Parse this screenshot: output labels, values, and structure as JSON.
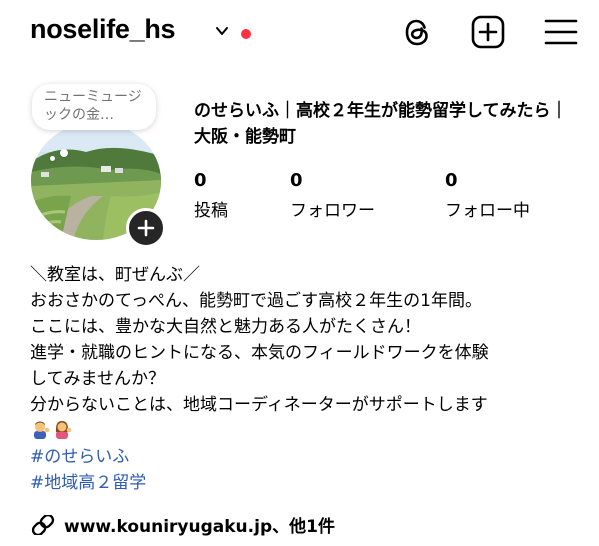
{
  "header": {
    "username": "noselife_hs",
    "chevron_icon": "chevron-down-icon",
    "notification_dot_color": "#ff3040",
    "threads_icon": "threads-icon",
    "create_icon": "plus-square-icon",
    "menu_icon": "hamburger-menu-icon"
  },
  "note": {
    "text": "ニューミュージックの金…"
  },
  "avatar": {
    "add_story_icon": "plus-icon"
  },
  "profile": {
    "display_name": "のせらいふ｜高校２年生が能勢留学してみたら｜大阪・能勢町"
  },
  "stats": [
    {
      "value": "0",
      "label": "投稿"
    },
    {
      "value": "0",
      "label": "フォロワー"
    },
    {
      "value": "0",
      "label": "フォロー中"
    }
  ],
  "bio": {
    "lines": [
      "＼教室は、町ぜんぶ／",
      "おおさかのてっぺん、能勢町で過ごす高校２年生の1年間。",
      "ここには、豊かな大自然と魅力ある人がたくさん！",
      "進学・就職のヒントになる、本気のフィールドワークを体験",
      "してみませんか？",
      "分からないことは、地域コーディネーターがサポートします"
    ],
    "emojis": [
      "man-tipping-hand",
      "woman-tipping-hand"
    ],
    "hashtags": [
      "#のせらいふ",
      "#地域高２留学"
    ]
  },
  "link": {
    "icon": "link-icon",
    "text": "www.kouniryugaku.jp、他1件"
  },
  "colors": {
    "hashtag": "#2e5bb5",
    "badge_bg": "#262626"
  }
}
